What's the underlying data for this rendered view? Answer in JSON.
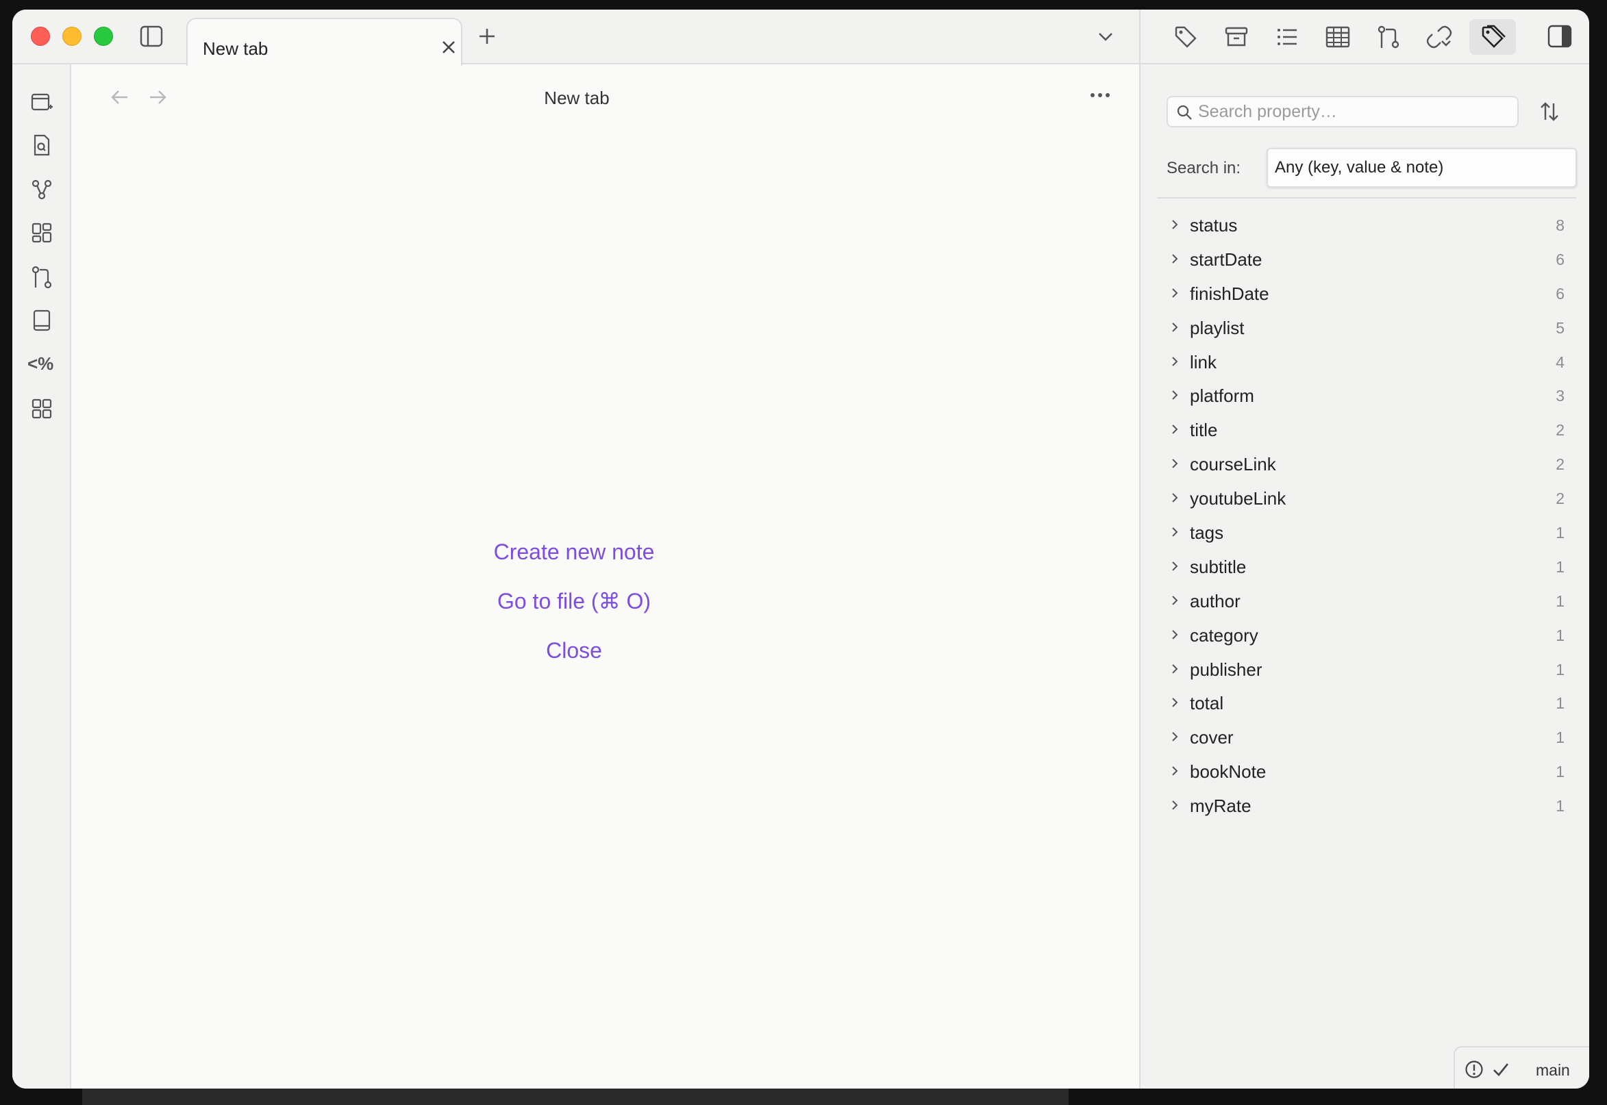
{
  "titlebar": {
    "tab_title": "New tab"
  },
  "view": {
    "title": "New tab",
    "actions": {
      "create_note": "Create new note",
      "go_to_file": "Go to file (⌘ O)",
      "close": "Close"
    }
  },
  "ribbon": {
    "items": [
      {
        "icon": "new-tab-icon"
      },
      {
        "icon": "file-search-icon"
      },
      {
        "icon": "graph-icon"
      },
      {
        "icon": "canvas-icon"
      },
      {
        "icon": "git-icon"
      },
      {
        "icon": "book-icon"
      },
      {
        "icon": "templater-icon",
        "label": "<%"
      },
      {
        "icon": "dashboard-icon"
      }
    ]
  },
  "properties": {
    "search_placeholder": "Search property…",
    "search_in_label": "Search in:",
    "search_in_value": "Any (key, value & note)",
    "items": [
      {
        "name": "status",
        "count": "8"
      },
      {
        "name": "startDate",
        "count": "6"
      },
      {
        "name": "finishDate",
        "count": "6"
      },
      {
        "name": "playlist",
        "count": "5"
      },
      {
        "name": "link",
        "count": "4"
      },
      {
        "name": "platform",
        "count": "3"
      },
      {
        "name": "title",
        "count": "2"
      },
      {
        "name": "courseLink",
        "count": "2"
      },
      {
        "name": "youtubeLink",
        "count": "2"
      },
      {
        "name": "tags",
        "count": "1"
      },
      {
        "name": "subtitle",
        "count": "1"
      },
      {
        "name": "author",
        "count": "1"
      },
      {
        "name": "category",
        "count": "1"
      },
      {
        "name": "publisher",
        "count": "1"
      },
      {
        "name": "total",
        "count": "1"
      },
      {
        "name": "cover",
        "count": "1"
      },
      {
        "name": "bookNote",
        "count": "1"
      },
      {
        "name": "myRate",
        "count": "1"
      }
    ]
  },
  "statusbar": {
    "branch": "main"
  },
  "colors": {
    "accent": "#7c4ddf",
    "close_red": "#fe5f57",
    "minimize_yellow": "#febc2e",
    "zoom_green": "#28c840"
  }
}
